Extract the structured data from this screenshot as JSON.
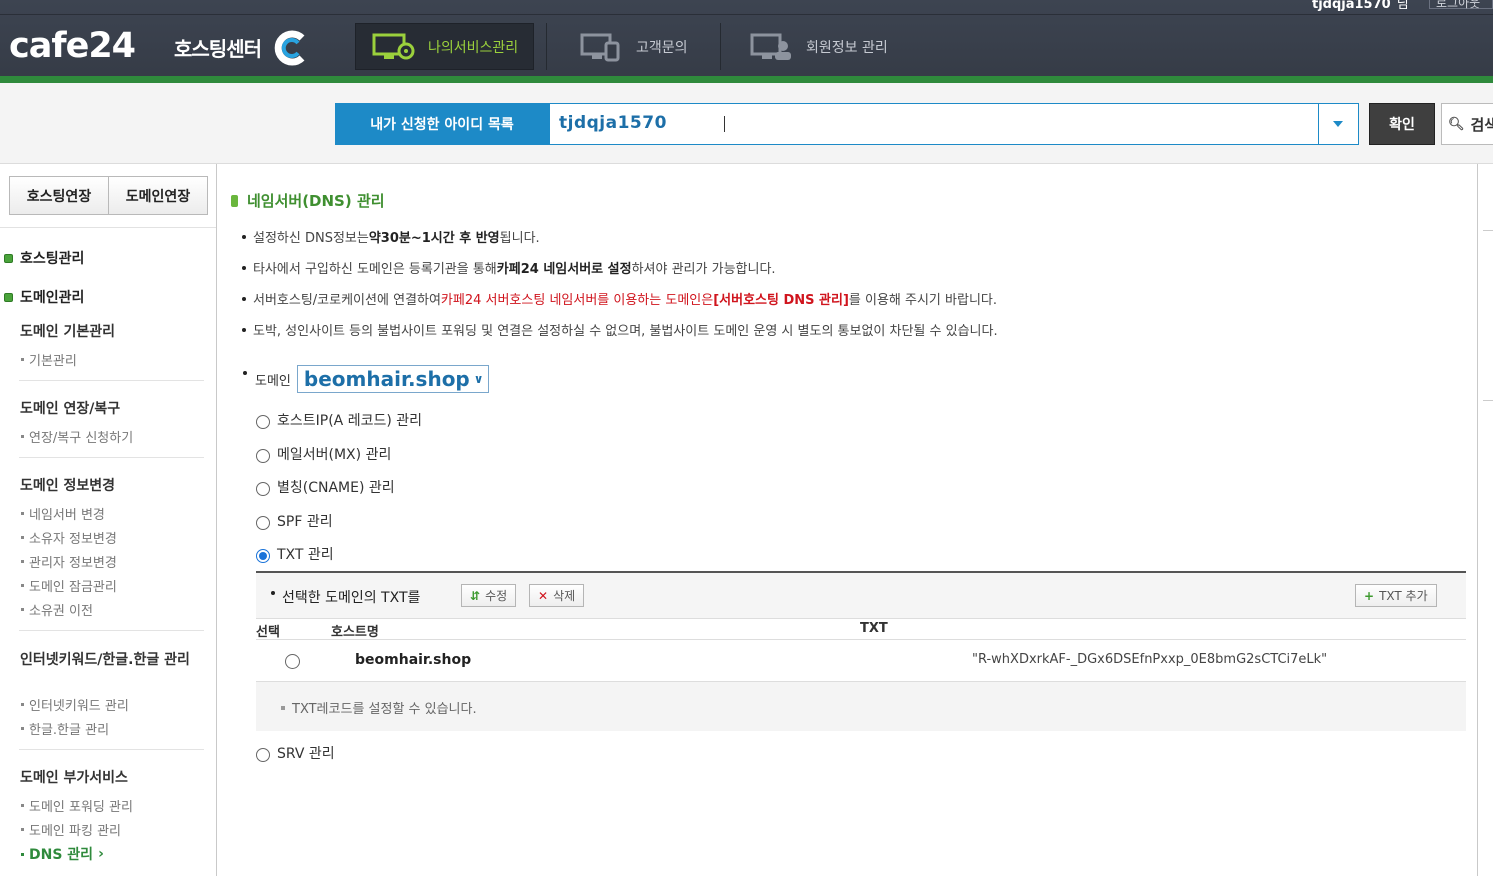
{
  "header": {
    "user_id": "tjdqja1570",
    "user_suffix": "님",
    "logout": "로그아웃",
    "logo_text": "cafe24",
    "logo_sub": "호스팅센터",
    "nav": [
      {
        "label": "나의서비스관리",
        "active": true
      },
      {
        "label": "고객문의",
        "active": false
      },
      {
        "label": "회원정보 관리",
        "active": false
      }
    ]
  },
  "search": {
    "id_label": "내가 신청한 아이디 목록",
    "id_value": "tjdqja1570",
    "confirm_label": "확인",
    "search_label": "검색"
  },
  "sidebar": {
    "renew_hosting": "호스팅연장",
    "renew_domain": "도메인연장",
    "main_hosting": "호스팅관리",
    "main_domain": "도메인관리",
    "sections": [
      {
        "title": "도메인 기본관리",
        "items": [
          "기본관리"
        ]
      },
      {
        "title": "도메인 연장/복구",
        "items": [
          "연장/복구 신청하기"
        ]
      },
      {
        "title": "도메인 정보변경",
        "items": [
          "네임서버 변경",
          "소유자 정보변경",
          "관리자 정보변경",
          "도메인 잠금관리",
          "소유권 이전"
        ]
      },
      {
        "title": "인터넷키워드/한글.한글 관리",
        "items": [
          "인터넷키워드 관리",
          "한글.한글 관리"
        ]
      },
      {
        "title": "도메인 부가서비스",
        "items": [
          "도메인 포워딩 관리",
          "도메인 파킹 관리",
          "DNS 관리"
        ]
      }
    ],
    "active_item": "DNS 관리"
  },
  "main": {
    "title": "네임서버(DNS) 관리",
    "notices": [
      {
        "a": "설정하신 DNS정보는 ",
        "b": "약30분~1시간 후 반영",
        "c": "됩니다."
      },
      {
        "a": "타사에서 구입하신 도메인은 등록기관을 통해 ",
        "b": "카페24 네임서버로 설정",
        "c": "하셔야 관리가 가능합니다."
      },
      {
        "a": "서버호스팅/코로케이션에 연결하여 ",
        "r1": "카페24 서버호스팅 네임서버를 이용하는 도메인은",
        "r2": "[서버호스팅 DNS 관리]",
        "c": "를 이용해 주시기 바랍니다."
      },
      {
        "a": "도박, 성인사이트 등의 불법사이트 포워딩 및 연결은 설정하실 수 없으며, 불법사이트 도메인 운영 시 별도의 통보없이 차단될 수 있습니다."
      }
    ],
    "domain_label": "도메인",
    "domain_value": "beomhair.shop",
    "radios": [
      {
        "label": "호스트IP(A 레코드) 관리",
        "checked": false
      },
      {
        "label": "메일서버(MX) 관리",
        "checked": false
      },
      {
        "label": "별칭(CNAME) 관리",
        "checked": false
      },
      {
        "label": "SPF 관리",
        "checked": false
      },
      {
        "label": "TXT 관리",
        "checked": true
      },
      {
        "label": "SRV 관리",
        "checked": false
      }
    ],
    "txt_panel": {
      "heading": "선택한 도메인의 TXT를",
      "edit_label": "수정",
      "delete_label": "삭제",
      "add_label": "TXT 추가",
      "columns": [
        "선택",
        "호스트명",
        "TXT"
      ],
      "rows": [
        {
          "host": "beomhair.shop",
          "txt": "\"R-whXDxrkAF-_DGx6DSEfnPxxp_0E8bmG2sCTCi7eLk\""
        }
      ],
      "footnote": "TXT레코드를 설정할 수 있습니다."
    }
  },
  "colors": {
    "accent_blue": "#1d8ac7",
    "brand_green": "#2f8a3c",
    "notice_red": "#d0141d",
    "header_bg": "#3d4451"
  }
}
